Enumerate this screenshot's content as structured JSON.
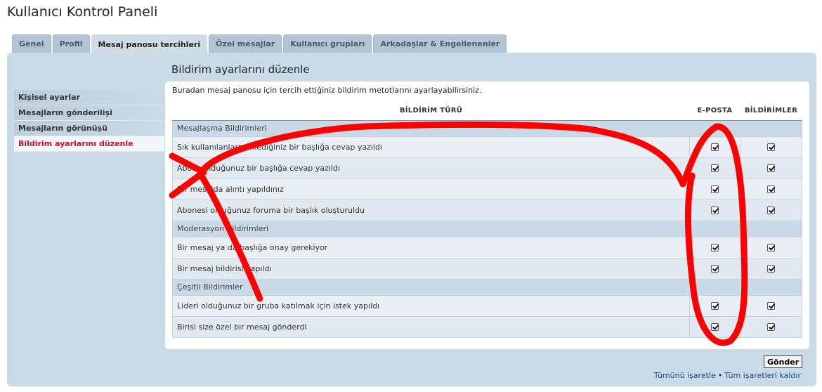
{
  "page": {
    "title": "Kullanıcı Kontrol Paneli"
  },
  "tabs": [
    {
      "label": "Genel",
      "active": false
    },
    {
      "label": "Profil",
      "active": false
    },
    {
      "label": "Mesaj panosu tercihleri",
      "active": true
    },
    {
      "label": "Özel mesajlar",
      "active": false
    },
    {
      "label": "Kullanıcı grupları",
      "active": false
    },
    {
      "label": "Arkadaşlar & Engellenenler",
      "active": false
    }
  ],
  "sidebar": {
    "items": [
      {
        "label": "Kişisel ayarlar",
        "active": false
      },
      {
        "label": "Mesajların gönderilişi",
        "active": false
      },
      {
        "label": "Mesajların görünüşü",
        "active": false
      },
      {
        "label": "Bildirim ayarlarını düzenle",
        "active": true
      }
    ]
  },
  "main": {
    "title": "Bildirim ayarlarını düzenle",
    "intro": "Buradan mesaj panosu için tercih ettiğiniz bildirim metotlarını ayarlayabilirsiniz.",
    "columns": {
      "type": "BİLDİRİM TÜRÜ",
      "email": "E-POSTA",
      "notifications": "BİLDİRİMLER"
    },
    "groups": [
      {
        "name": "Mesajlaşma Bildirimleri",
        "rows": [
          {
            "label": "Sık kullanılanlara eklediğiniz bir başlığa cevap yazıldı",
            "email": true,
            "notify": true
          },
          {
            "label": "Abone olduğunuz bir başlığa cevap yazıldı",
            "email": true,
            "notify": true
          },
          {
            "label": "Bir mesajda alıntı yapıldınız",
            "email": true,
            "notify": true
          },
          {
            "label": "Abonesi olduğunuz foruma bir başlık oluşturuldu",
            "email": true,
            "notify": true
          }
        ]
      },
      {
        "name": "Moderasyon Bildirimleri",
        "rows": [
          {
            "label": "Bir mesaj ya da başlığa onay gerekiyor",
            "email": true,
            "notify": true
          },
          {
            "label": "Bir mesaj bildirisi yapıldı",
            "email": true,
            "notify": true
          }
        ]
      },
      {
        "name": "Çeşitli Bildirimler",
        "rows": [
          {
            "label": "Lideri olduğunuz bir gruba katılmak için istek yapıldı",
            "email": true,
            "notify": true
          },
          {
            "label": "Birisi size özel bir mesaj gönderdi",
            "email": true,
            "notify": true
          }
        ]
      }
    ]
  },
  "actions": {
    "submit_label": "Gönder",
    "mark_all": "Tümünü işaretle",
    "separator": "•",
    "unmark_all": "Tüm işaretleri kaldır"
  },
  "colors": {
    "panel_bg": "#cadbe8",
    "active_sidebar_text": "#c4102f",
    "annotation_red": "#ff0000"
  }
}
